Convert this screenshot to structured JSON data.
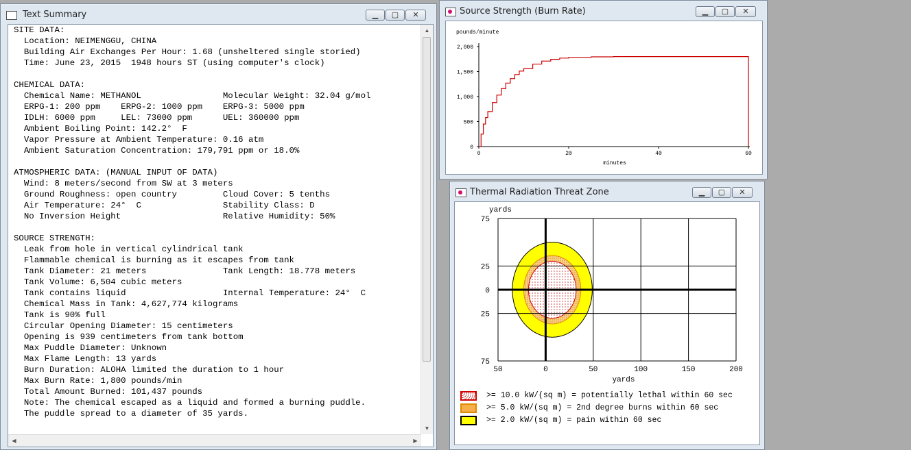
{
  "text_window": {
    "title": "Text Summary",
    "lines": [
      "SITE DATA:",
      "  Location: NEIMENGGU, CHINA",
      "  Building Air Exchanges Per Hour: 1.68 (unsheltered single storied)",
      "  Time: June 23, 2015  1948 hours ST (using computer's clock)",
      "",
      "CHEMICAL DATA:",
      "  Chemical Name: METHANOL                Molecular Weight: 32.04 g/mol",
      "  ERPG-1: 200 ppm    ERPG-2: 1000 ppm    ERPG-3: 5000 ppm",
      "  IDLH: 6000 ppm     LEL: 73000 ppm      UEL: 360000 ppm",
      "  Ambient Boiling Point: 142.2°  F",
      "  Vapor Pressure at Ambient Temperature: 0.16 atm",
      "  Ambient Saturation Concentration: 179,791 ppm or 18.0%",
      "",
      "ATMOSPHERIC DATA: (MANUAL INPUT OF DATA)",
      "  Wind: 8 meters/second from SW at 3 meters",
      "  Ground Roughness: open country         Cloud Cover: 5 tenths",
      "  Air Temperature: 24°  C                Stability Class: D",
      "  No Inversion Height                    Relative Humidity: 50%",
      "",
      "SOURCE STRENGTH:",
      "  Leak from hole in vertical cylindrical tank",
      "  Flammable chemical is burning as it escapes from tank",
      "  Tank Diameter: 21 meters               Tank Length: 18.778 meters",
      "  Tank Volume: 6,504 cubic meters",
      "  Tank contains liquid                   Internal Temperature: 24°  C",
      "  Chemical Mass in Tank: 4,627,774 kilograms",
      "  Tank is 90% full",
      "  Circular Opening Diameter: 15 centimeters",
      "  Opening is 939 centimeters from tank bottom",
      "  Max Puddle Diameter: Unknown",
      "  Max Flame Length: 13 yards",
      "  Burn Duration: ALOHA limited the duration to 1 hour",
      "  Max Burn Rate: 1,800 pounds/min",
      "  Total Amount Burned: 101,437 pounds",
      "  Note: The chemical escaped as a liquid and formed a burning puddle.",
      "  The puddle spread to a diameter of 35 yards."
    ]
  },
  "source_window": {
    "title": "Source Strength (Burn Rate)",
    "chart_data": {
      "type": "line",
      "title": "",
      "ylabel": "pounds/minute",
      "xlabel": "minutes",
      "x_ticks": [
        "0",
        "20",
        "40",
        "60"
      ],
      "y_ticks": [
        "0",
        "500",
        "1,000",
        "1,500",
        "2,000"
      ],
      "xlim": [
        0,
        60
      ],
      "ylim": [
        0,
        2000
      ],
      "series": [
        {
          "color": "#cc0000",
          "x": [
            0,
            0.5,
            1,
            1.5,
            2,
            3,
            4,
            5,
            6,
            7,
            8,
            9,
            10,
            12,
            14,
            16,
            18,
            20,
            25,
            30,
            40,
            50,
            60
          ],
          "values": [
            0,
            250,
            450,
            580,
            700,
            880,
            1030,
            1160,
            1270,
            1360,
            1440,
            1510,
            1560,
            1650,
            1710,
            1745,
            1770,
            1785,
            1795,
            1800,
            1800,
            1800,
            1800
          ]
        }
      ]
    }
  },
  "thermal_window": {
    "title": "Thermal Radiation Threat Zone",
    "chart_data": {
      "type": "area",
      "title": "",
      "y_unit": "yards",
      "xlabel": "yards",
      "x_ticks": [
        "50",
        "0",
        "50",
        "100",
        "150",
        "200"
      ],
      "y_ticks": [
        "75",
        "25",
        "0",
        "25",
        "75"
      ],
      "xlim": [
        -50,
        200
      ],
      "ylim": [
        -75,
        75
      ],
      "zones": [
        {
          "label": ">= 2.0 kW/(sq m) = pain within 60 sec",
          "fill": "#ffff00",
          "border": "#000000",
          "center_x": 7,
          "radius_x": 42,
          "radius_y": 50
        },
        {
          "label": ">= 5.0 kW/(sq m) = 2nd degree burns within 60 sec",
          "fill": "#f5a623",
          "border": "#e08a00",
          "center_x": 7,
          "radius_x": 30,
          "radius_y": 36
        },
        {
          "label": ">= 10.0 kW/(sq m) = potentially lethal within 60 sec",
          "fill": "#ffffff",
          "border": "#cc0000",
          "center_x": 7,
          "radius_x": 25,
          "radius_y": 30
        }
      ]
    },
    "legend": [
      {
        "label": ">= 10.0 kW/(sq m) = potentially lethal within 60 sec",
        "fill": "#ffffff",
        "border": "#d00000"
      },
      {
        "label": ">= 5.0 kW/(sq m) = 2nd degree burns within 60 sec",
        "fill": "#f5b04a",
        "border": "#e08a00"
      },
      {
        "label": ">= 2.0 kW/(sq m) = pain within 60 sec",
        "fill": "#ffff00",
        "border": "#000000"
      }
    ]
  }
}
